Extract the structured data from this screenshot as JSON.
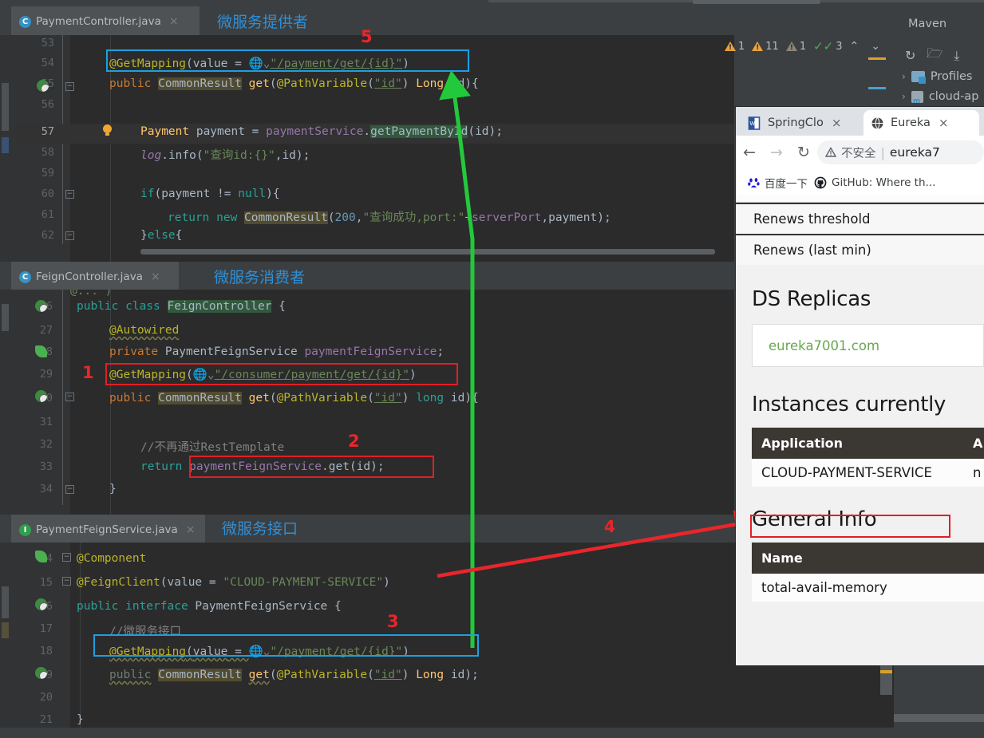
{
  "ide": {
    "editors": [
      {
        "tab": {
          "label": "PaymentController.java",
          "icon": "class-icon",
          "close": "×"
        },
        "note": "微服务提供者",
        "lines": [
          {
            "n": "53",
            "text": ""
          },
          {
            "n": "54",
            "text": "    @GetMapping(value = \"/payment/get/{id}\")"
          },
          {
            "n": "55",
            "text": "    public CommonResult get(@PathVariable(\"id\") Long id){"
          },
          {
            "n": "56",
            "text": ""
          },
          {
            "n": "57",
            "text": "        Payment payment = paymentService.getPaymentById(id);"
          },
          {
            "n": "58",
            "text": "        log.info(\"查询id:{}\",id);"
          },
          {
            "n": "59",
            "text": ""
          },
          {
            "n": "60",
            "text": "        if(payment != null){"
          },
          {
            "n": "61",
            "text": "            return new CommonResult(200,\"查询成功,port:\"+serverPort,payment);"
          },
          {
            "n": "62",
            "text": "        }else{"
          }
        ]
      },
      {
        "tab": {
          "label": "FeignController.java",
          "icon": "class-icon",
          "close": "×"
        },
        "note": "微服务消费者",
        "lines": [
          {
            "n": "26",
            "text": "public class FeignController {"
          },
          {
            "n": "27",
            "text": "    @Autowired"
          },
          {
            "n": "28",
            "text": "    private PaymentFeignService paymentFeignService;"
          },
          {
            "n": "29",
            "text": "    @GetMapping(\"/consumer/payment/get/{id}\")"
          },
          {
            "n": "30",
            "text": "    public CommonResult get(@PathVariable(\"id\") long id){"
          },
          {
            "n": "31",
            "text": ""
          },
          {
            "n": "32",
            "text": "        //不再通过RestTemplate"
          },
          {
            "n": "33",
            "text": "        return paymentFeignService.get(id);"
          },
          {
            "n": "34",
            "text": "    }"
          }
        ]
      },
      {
        "tab": {
          "label": "PaymentFeignService.java",
          "icon": "interface-icon",
          "close": "×"
        },
        "note": "微服务接口",
        "lines": [
          {
            "n": "14",
            "text": "@Component"
          },
          {
            "n": "15",
            "text": "@FeignClient(value = \"CLOUD-PAYMENT-SERVICE\")"
          },
          {
            "n": "16",
            "text": "public interface PaymentFeignService {"
          },
          {
            "n": "17",
            "text": "    //微服务接口"
          },
          {
            "n": "18",
            "text": "    @GetMapping(value = \"/payment/get/{id}\")"
          },
          {
            "n": "19",
            "text": "    public CommonResult get(@PathVariable(\"id\") Long id);"
          },
          {
            "n": "20",
            "text": ""
          },
          {
            "n": "21",
            "text": "}"
          }
        ]
      }
    ],
    "inspection_status": [
      {
        "icon": "warning-triangle-icon",
        "color": "#e8a33d",
        "count": "1"
      },
      {
        "icon": "warning-triangle-icon",
        "color": "#e8a33d",
        "count": "11"
      },
      {
        "icon": "warning-triangle-icon",
        "color": "#8a8578",
        "count": "1"
      },
      {
        "icon": "check-icon",
        "color": "#4caf50",
        "count": "3"
      }
    ],
    "inspection_nav": {
      "up": "⌃",
      "down": "⌄"
    },
    "maven": {
      "title": "Maven",
      "toolbar": [
        {
          "icon": "refresh-icon",
          "glyph": "↻"
        },
        {
          "icon": "add-maven-project-icon",
          "glyph": "὜1"
        },
        {
          "icon": "download-sources-icon",
          "glyph": "⤓"
        }
      ],
      "tree": [
        {
          "twisty": "›",
          "icon": "profiles-icon",
          "label": "Profiles"
        },
        {
          "twisty": "›",
          "icon": "maven-module-icon",
          "label": "cloud-ap"
        }
      ]
    }
  },
  "annotations": {
    "marks": [
      {
        "id": "1",
        "color": "#e8262c",
        "shape": "red-box"
      },
      {
        "id": "2",
        "color": "#e8262c",
        "shape": "red-box"
      },
      {
        "id": "3",
        "color": "#e8262c",
        "shape": "blue-box"
      },
      {
        "id": "4",
        "color": "#e8262c",
        "shape": "red-arrow"
      },
      {
        "id": "5",
        "color": "#e8262c",
        "shape": "blue-box"
      }
    ],
    "green_arrow": {
      "color": "#22c93a",
      "direction": "up"
    },
    "red_arrow": {
      "color": "#e8262c",
      "direction": "right"
    }
  },
  "browser": {
    "tabs": [
      {
        "title": "SpringClo",
        "favicon": "word-doc-icon",
        "close": "×",
        "active": false
      },
      {
        "title": "Eureka",
        "favicon": "globe-icon",
        "close": "×",
        "active": true
      }
    ],
    "nav": {
      "back": "←",
      "forward": "→",
      "reload": "↻",
      "security_icon": "not-secure-warning-icon",
      "security_label": "不安全",
      "separator": "|",
      "url": "eureka7"
    },
    "bookmarks": [
      {
        "icon": "baidu-icon",
        "label": "百度一下"
      },
      {
        "icon": "github-icon",
        "label": "GitHub: Where th..."
      }
    ],
    "page": {
      "rows": [
        {
          "label": "Renews threshold"
        },
        {
          "label": "Renews (last min)"
        }
      ],
      "ds_replicas_heading": "DS Replicas",
      "ds_replica_link": "eureka7001.com",
      "instances_heading": "Instances currently",
      "instances_table": {
        "header": [
          "Application",
          "A"
        ],
        "rows": [
          [
            "CLOUD-PAYMENT-SERVICE",
            "n"
          ]
        ]
      },
      "general_info_heading": "General Info",
      "general_info_table": {
        "header": [
          "Name"
        ],
        "rows": [
          [
            "total-avail-memory"
          ]
        ]
      }
    }
  }
}
